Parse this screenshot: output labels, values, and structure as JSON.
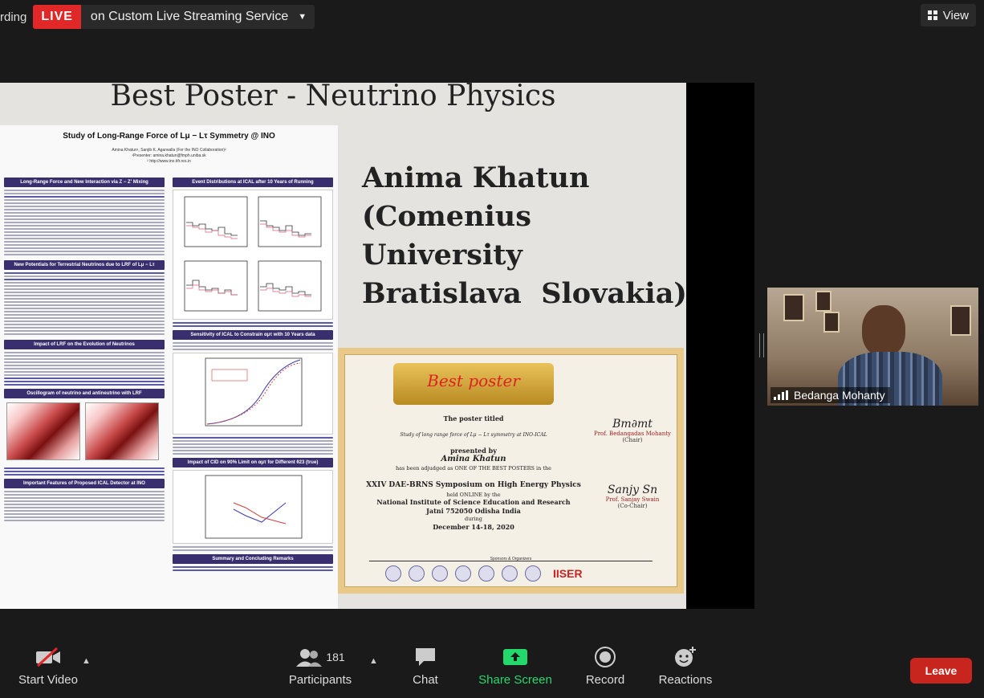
{
  "topbar": {
    "recording_text": "rding",
    "live_label": "LIVE",
    "live_service": "on Custom Live Streaming Service",
    "view_label": "View"
  },
  "slide": {
    "title": "Best Poster - Neutrino Physics",
    "name_block": "Anima Khatun\n(Comenius\nUniversity\nBratislava  Slovakia)"
  },
  "poster": {
    "title": "Study of Long-Range Force of Lμ − Lτ Symmetry @ INO",
    "authors": "Amina Khatun¹, Sanjib K. Agarwalla (For the INO Collaboration)²",
    "presenter": "¹Presenter: amina.khatun@fmph.uniba.sk",
    "url": "² http://www.ino.tifr.res.in",
    "left_sections": [
      "Long-Range Force and New Interaction via Z − Z′ Mixing",
      "New Potentials for Terrestrial Neutrinos due to LRF of Lμ − Lτ",
      "Impact of LRF on the Evolution of Neutrinos",
      "Oscillogram of neutrino and antineutrino with LRF",
      "Important Features of Proposed ICAL Detector at INO"
    ],
    "right_sections": [
      "Event Distributions at ICAL after 10 Years of Running",
      "Sensitivity of ICAL to Constrain αμτ with 10 Years data",
      "Impact of CID on 90% Limit on αμτ for Different θ23 (true)",
      "Summary and Concluding Remarks"
    ]
  },
  "certificate": {
    "ribbon": "Best poster",
    "line1": "The poster titled",
    "line2": "Study of long range force of Lμ − Lτ symmetry at INO-ICAL",
    "line3": "presented by",
    "presenter": "Amina Khatun",
    "line4": "has been adjudged as ONE OF THE BEST POSTERS in the",
    "symposium": "XXIV DAE-BRNS Symposium on High Energy Physics",
    "held": "held ONLINE by the",
    "institute": "National Institute of Science Education and Research",
    "place": "Jatni 752050 Odisha India",
    "during": "during",
    "dates": "December 14-18, 2020",
    "chair_name": "Prof. Bedangadas Mohanty",
    "chair_role": "(Chair)",
    "cochair_name": "Prof. Sanjay Swain",
    "cochair_role": "(Co-Chair)",
    "sponsors": "Sponsors & Organizers",
    "iiser": "IISER"
  },
  "video": {
    "participant_name": "Bedanga Mohanty"
  },
  "toolbar": {
    "start_video": "Start Video",
    "participants_count": "181",
    "participants": "Participants",
    "chat": "Chat",
    "share_screen": "Share Screen",
    "record": "Record",
    "reactions": "Reactions",
    "leave": "Leave"
  },
  "colors": {
    "live_red": "#e02828",
    "share_green": "#23d96c",
    "leave_red": "#c9251f"
  }
}
